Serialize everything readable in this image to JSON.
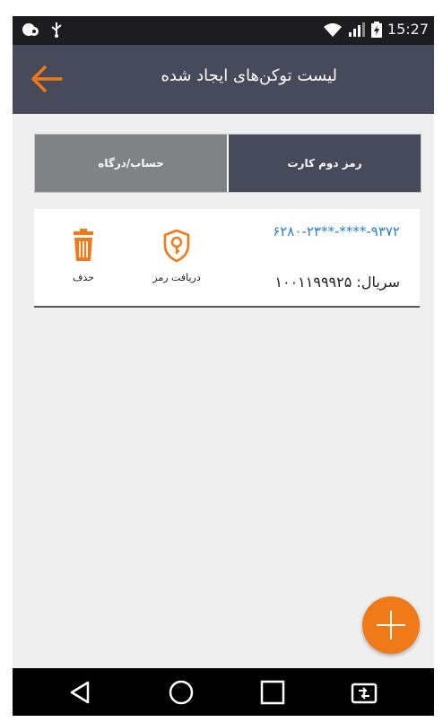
{
  "status_bar": {
    "time": "15:27",
    "icons": [
      "app-notification-icon",
      "usb-icon",
      "wifi-icon",
      "signal-icon",
      "battery-icon"
    ]
  },
  "app_bar": {
    "title": "لیست توکن‌های ایجاد شده",
    "back_icon": "arrow-left-icon"
  },
  "tabs": [
    {
      "label": "حساب/درگاه",
      "selected": false
    },
    {
      "label": "رمز دوم کارت",
      "selected": true
    }
  ],
  "token": {
    "card_number": "۶۲۸۰-۲۳**-****-۹۳۷۲",
    "serial_label": "سریال:",
    "serial_value": "۱۰۰۱۱۹۹۹۲۵",
    "actions": {
      "get_password": "دریافت رمز",
      "delete": "حذف"
    }
  },
  "colors": {
    "header": "#464a5b",
    "accent": "#f07a17",
    "link": "#2a7fc7",
    "background": "#efeff0"
  },
  "nav_icons": [
    "back-triangle-icon",
    "home-circle-icon",
    "recents-square-icon",
    "screen-rotate-icon"
  ]
}
